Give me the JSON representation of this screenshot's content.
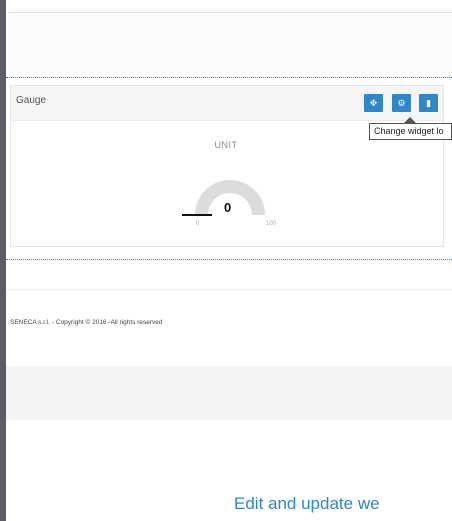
{
  "widget": {
    "title": "Gauge",
    "buttons": {
      "move_icon": "move-icon",
      "settings_icon": "gear-icon",
      "delete_icon": "trash-icon"
    },
    "tooltip": "Change widget lo",
    "gauge": {
      "unit": "UNIT",
      "value": "0",
      "min_label": "0",
      "max_label": "100",
      "value_fraction": 0
    }
  },
  "footer": {
    "copyright": "SENECA s.r.l. - Copyright © 2016 -All rights reserved"
  },
  "caption": "Edit and update we",
  "colors": {
    "accent": "#2f86c8",
    "sidebar_border": "#5a5d66",
    "gauge_track": "#dcdcdc"
  }
}
